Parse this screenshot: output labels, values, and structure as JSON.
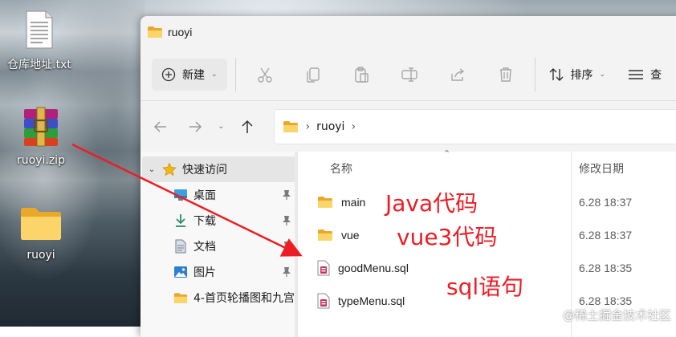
{
  "desktop": {
    "icons": [
      {
        "label": "仓库地址.txt",
        "icon": "text-file-icon"
      },
      {
        "label": "ruoyi.zip",
        "icon": "winrar-archive-icon"
      },
      {
        "label": "ruoyi",
        "icon": "folder-icon"
      }
    ]
  },
  "window": {
    "title": "ruoyi",
    "ribbon": {
      "new_label": "新建",
      "sort_label": "排序",
      "view_label": "查",
      "icons": [
        "cut-icon",
        "copy-icon",
        "paste-icon",
        "rename-icon",
        "share-icon",
        "delete-icon"
      ]
    },
    "address": {
      "path": [
        "ruoyi"
      ]
    },
    "sidebar": {
      "items": [
        {
          "label": "快速访问",
          "icon": "star-icon",
          "pinned": false
        },
        {
          "label": "桌面",
          "icon": "desktop-icon",
          "pinned": true
        },
        {
          "label": "下载",
          "icon": "download-icon",
          "pinned": true
        },
        {
          "label": "文档",
          "icon": "document-icon",
          "pinned": true
        },
        {
          "label": "图片",
          "icon": "picture-icon",
          "pinned": true
        },
        {
          "label": "4-首页轮播图和九宫",
          "icon": "folder-icon",
          "pinned": false
        }
      ]
    },
    "filelist": {
      "columns": {
        "name": "名称",
        "modified": "修改日期"
      },
      "rows": [
        {
          "name": "main",
          "type": "folder",
          "modified": "6.28 18:37"
        },
        {
          "name": "vue",
          "type": "folder",
          "modified": "6.28 18:37"
        },
        {
          "name": "goodMenu.sql",
          "type": "sql",
          "modified": "6.28 18:35"
        },
        {
          "name": "typeMenu.sql",
          "type": "sql",
          "modified": "6.28 18:35"
        }
      ]
    }
  },
  "annotations": {
    "java": "Java代码",
    "vue3": "vue3代码",
    "sql": "sql语句",
    "color": "#ee1c25"
  },
  "watermark": "@稀土掘金技术社区"
}
